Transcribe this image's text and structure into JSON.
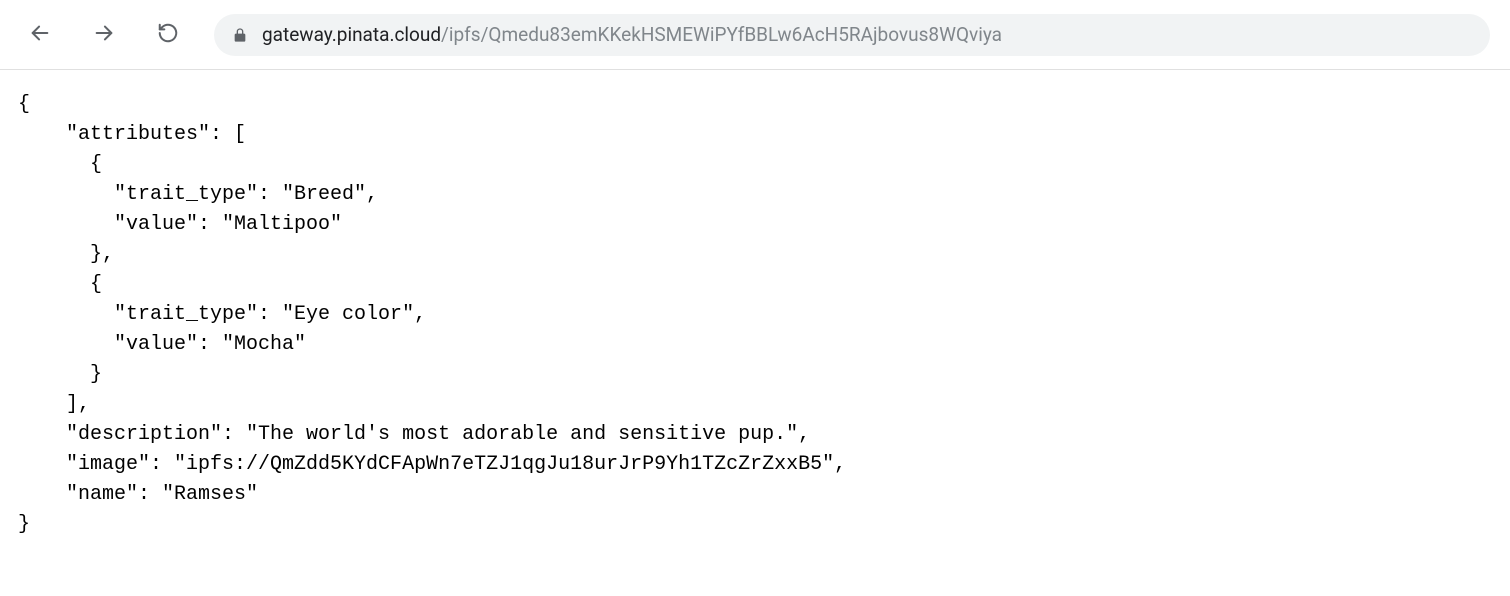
{
  "browser": {
    "url_domain": "gateway.pinata.cloud",
    "url_path": "/ipfs/Qmedu83emKKekHSMEWiPYfBBLw6AcH5RAjbovus8WQviya"
  },
  "json_body": {
    "line1": "{",
    "line2": "    \"attributes\": [",
    "line3": "      {",
    "line4": "        \"trait_type\": \"Breed\",",
    "line5": "        \"value\": \"Maltipoo\"",
    "line6": "      },",
    "line7": "      {",
    "line8": "        \"trait_type\": \"Eye color\",",
    "line9": "        \"value\": \"Mocha\"",
    "line10": "      }",
    "line11": "    ],",
    "line12": "    \"description\": \"The world's most adorable and sensitive pup.\",",
    "line13": "    \"image\": \"ipfs://QmZdd5KYdCFApWn7eTZJ1qgJu18urJrP9Yh1TZcZrZxxB5\",",
    "line14": "    \"name\": \"Ramses\"",
    "line15": "}"
  }
}
